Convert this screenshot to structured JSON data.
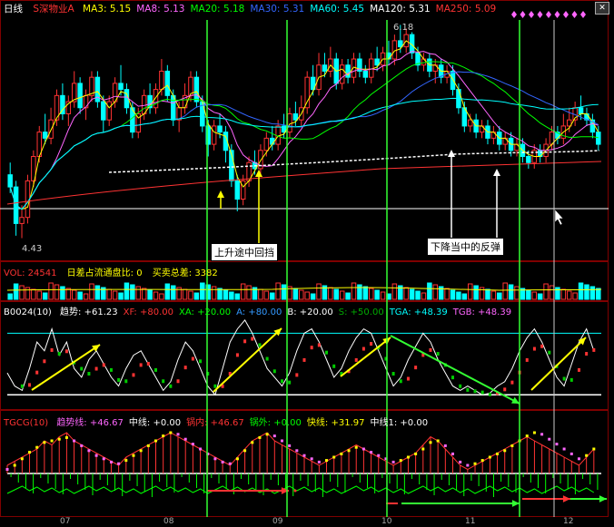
{
  "window": {
    "period_label": "日线",
    "close_glyph": "✕"
  },
  "price_panel": {
    "stock_name": "S深物业A",
    "ma": [
      {
        "label": "MA3:",
        "value": "5.15",
        "color": "#ffff00"
      },
      {
        "label": "MA8:",
        "value": "5.13",
        "color": "#ff66ff"
      },
      {
        "label": "MA20:",
        "value": "5.18",
        "color": "#00ff00"
      },
      {
        "label": "MA30:",
        "value": "5.31",
        "color": "#3366ff"
      },
      {
        "label": "MA60:",
        "value": "5.45",
        "color": "#00ffff"
      },
      {
        "label": "MA120:",
        "value": "5.31",
        "color": "#ffffff"
      },
      {
        "label": "MA250:",
        "value": "5.09",
        "color": "#ff3333"
      }
    ],
    "high_label": "6.18",
    "low_label": "4.43",
    "annotation_up": "上升途中回挡",
    "annotation_down": "下降当中的反弹"
  },
  "vol_panel": {
    "title": "VOL: 24541",
    "ratio": "日差占流通盘比: 0",
    "diff": "买卖总差: 3382"
  },
  "b0024_panel": {
    "name": "B0024(10)",
    "fields": [
      {
        "label": "趋势:",
        "value": "+61.23",
        "color": "#ffffff"
      },
      {
        "label": "XF:",
        "value": "+80.00",
        "color": "#ff3333"
      },
      {
        "label": "XA:",
        "value": "+20.00",
        "color": "#00ff00"
      },
      {
        "label": "A:",
        "value": "+80.00",
        "color": "#3399ff"
      },
      {
        "label": "B:",
        "value": "+20.00",
        "color": "#ffffff"
      },
      {
        "label": "S:",
        "value": "+50.00",
        "color": "#00aa00"
      },
      {
        "label": "TGA:",
        "value": "+48.39",
        "color": "#00ffff"
      },
      {
        "label": "TGB:",
        "value": "+48.39",
        "color": "#ff66ff"
      }
    ]
  },
  "tgcg_panel": {
    "name": "TGCG(10)",
    "fields": [
      {
        "label": "趋势线:",
        "value": "+46.67",
        "color": "#ff66ff"
      },
      {
        "label": "中线:",
        "value": "+0.00",
        "color": "#ffffff"
      },
      {
        "label": "锅内:",
        "value": "+46.67",
        "color": "#ff3333"
      },
      {
        "label": "锅外:",
        "value": "+0.00",
        "color": "#00ff00"
      },
      {
        "label": "快线:",
        "value": "+31.97",
        "color": "#ffff00"
      },
      {
        "label": "中线1:",
        "value": "+0.00",
        "color": "#ffffff"
      }
    ]
  },
  "date_axis": [
    "07",
    "08",
    "09",
    "10",
    "11",
    "12"
  ],
  "colors": {
    "up": "#ff3333",
    "down": "#00ffff",
    "vline": "#33ff33",
    "grid": "#800000",
    "arrow_yellow": "#ffff00",
    "arrow_green": "#33ff33"
  },
  "chart_data": {
    "type": "candlestick",
    "candles": [
      [
        4.95,
        4.85,
        5.05,
        4.8
      ],
      [
        4.85,
        4.55,
        4.9,
        4.45
      ],
      [
        4.55,
        4.6,
        4.7,
        4.43
      ],
      [
        4.6,
        4.9,
        4.95,
        4.55
      ],
      [
        4.9,
        5.1,
        5.15,
        4.85
      ],
      [
        5.1,
        5.3,
        5.35,
        5.05
      ],
      [
        5.3,
        5.25,
        5.45,
        5.2
      ],
      [
        5.25,
        5.4,
        5.5,
        5.2
      ],
      [
        5.4,
        5.6,
        5.65,
        5.35
      ],
      [
        5.6,
        5.45,
        5.7,
        5.4
      ],
      [
        5.45,
        5.55,
        5.6,
        5.35
      ],
      [
        5.55,
        5.7,
        5.8,
        5.5
      ],
      [
        5.7,
        5.5,
        5.75,
        5.45
      ],
      [
        5.5,
        5.6,
        5.65,
        5.4
      ],
      [
        5.6,
        5.75,
        5.8,
        5.55
      ],
      [
        5.75,
        5.55,
        5.8,
        5.5
      ],
      [
        5.55,
        5.4,
        5.6,
        5.3
      ],
      [
        5.4,
        5.55,
        5.6,
        5.35
      ],
      [
        5.55,
        5.7,
        5.75,
        5.5
      ],
      [
        5.7,
        5.65,
        5.85,
        5.6
      ],
      [
        5.65,
        5.5,
        5.7,
        5.45
      ],
      [
        5.5,
        5.3,
        5.55,
        5.25
      ],
      [
        5.3,
        5.45,
        5.5,
        5.25
      ],
      [
        5.45,
        5.6,
        5.65,
        5.4
      ],
      [
        5.6,
        5.5,
        5.7,
        5.45
      ],
      [
        5.5,
        5.65,
        5.7,
        5.45
      ],
      [
        5.65,
        5.8,
        5.9,
        5.6
      ],
      [
        5.8,
        5.6,
        5.85,
        5.55
      ],
      [
        5.6,
        5.4,
        5.65,
        5.35
      ],
      [
        5.4,
        5.5,
        5.55,
        5.3
      ],
      [
        5.5,
        5.6,
        5.7,
        5.45
      ],
      [
        5.6,
        5.75,
        5.8,
        5.55
      ],
      [
        5.75,
        5.55,
        5.8,
        5.5
      ],
      [
        5.55,
        5.35,
        5.6,
        5.3
      ],
      [
        5.35,
        5.2,
        5.4,
        5.1
      ],
      [
        5.2,
        5.35,
        5.4,
        5.15
      ],
      [
        5.35,
        5.3,
        5.45,
        5.25
      ],
      [
        5.3,
        5.15,
        5.35,
        5.05
      ],
      [
        5.15,
        4.9,
        5.2,
        4.85
      ],
      [
        4.9,
        4.75,
        4.95,
        4.65
      ],
      [
        4.75,
        4.9,
        4.95,
        4.7
      ],
      [
        4.9,
        5.05,
        5.1,
        4.85
      ],
      [
        5.05,
        5.0,
        5.15,
        4.95
      ],
      [
        5.0,
        5.15,
        5.2,
        4.95
      ],
      [
        5.15,
        5.25,
        5.3,
        5.1
      ],
      [
        5.25,
        5.2,
        5.35,
        5.15
      ],
      [
        5.2,
        5.35,
        5.4,
        5.15
      ],
      [
        5.35,
        5.3,
        5.45,
        5.25
      ],
      [
        5.3,
        5.45,
        5.5,
        5.25
      ],
      [
        5.45,
        5.4,
        5.55,
        5.35
      ],
      [
        5.4,
        5.5,
        5.6,
        5.35
      ],
      [
        5.5,
        5.75,
        5.8,
        5.45
      ],
      [
        5.75,
        5.65,
        5.85,
        5.6
      ],
      [
        5.65,
        5.85,
        5.95,
        5.6
      ],
      [
        5.85,
        5.8,
        5.95,
        5.75
      ],
      [
        5.8,
        5.9,
        6.0,
        5.75
      ],
      [
        5.9,
        5.7,
        5.95,
        5.65
      ],
      [
        5.7,
        5.85,
        5.9,
        5.65
      ],
      [
        5.85,
        5.75,
        5.9,
        5.7
      ],
      [
        5.75,
        5.9,
        5.95,
        5.7
      ],
      [
        5.9,
        5.8,
        5.95,
        5.75
      ],
      [
        5.8,
        5.75,
        5.85,
        5.7
      ],
      [
        5.75,
        5.9,
        5.95,
        5.7
      ],
      [
        5.9,
        5.85,
        6.0,
        5.8
      ],
      [
        5.85,
        5.95,
        6.0,
        5.8
      ],
      [
        5.95,
        5.9,
        6.05,
        5.85
      ],
      [
        5.9,
        6.05,
        6.1,
        5.85
      ],
      [
        6.05,
        6.0,
        6.18,
        5.95
      ],
      [
        6.0,
        6.1,
        6.15,
        5.95
      ],
      [
        6.1,
        5.95,
        6.12,
        5.9
      ],
      [
        5.95,
        5.85,
        6.0,
        5.8
      ],
      [
        5.85,
        5.9,
        5.95,
        5.8
      ],
      [
        5.9,
        5.8,
        5.95,
        5.75
      ],
      [
        5.8,
        5.85,
        5.9,
        5.7
      ],
      [
        5.85,
        5.75,
        5.9,
        5.7
      ],
      [
        5.75,
        5.8,
        5.85,
        5.7
      ],
      [
        5.8,
        5.65,
        5.85,
        5.6
      ],
      [
        5.65,
        5.5,
        5.7,
        5.45
      ],
      [
        5.5,
        5.35,
        5.55,
        5.3
      ],
      [
        5.35,
        5.4,
        5.45,
        5.3
      ],
      [
        5.4,
        5.3,
        5.45,
        5.25
      ],
      [
        5.3,
        5.35,
        5.4,
        5.25
      ],
      [
        5.35,
        5.25,
        5.4,
        5.2
      ],
      [
        5.25,
        5.3,
        5.35,
        5.2
      ],
      [
        5.3,
        5.2,
        5.35,
        5.15
      ],
      [
        5.2,
        5.25,
        5.3,
        5.15
      ],
      [
        5.25,
        5.15,
        5.3,
        5.1
      ],
      [
        5.15,
        5.2,
        5.25,
        5.1
      ],
      [
        5.2,
        5.1,
        5.25,
        5.05
      ],
      [
        5.1,
        5.05,
        5.15,
        5.0
      ],
      [
        5.05,
        5.15,
        5.2,
        5.0
      ],
      [
        5.15,
        5.1,
        5.2,
        5.05
      ],
      [
        5.1,
        5.2,
        5.25,
        5.05
      ],
      [
        5.2,
        5.3,
        5.35,
        5.15
      ],
      [
        5.3,
        5.25,
        5.35,
        5.2
      ],
      [
        5.25,
        5.35,
        5.45,
        5.2
      ],
      [
        5.35,
        5.4,
        5.5,
        5.3
      ],
      [
        5.4,
        5.5,
        5.55,
        5.35
      ],
      [
        5.5,
        5.45,
        5.6,
        5.4
      ],
      [
        5.45,
        5.4,
        5.5,
        5.35
      ],
      [
        5.4,
        5.3,
        5.45,
        5.25
      ],
      [
        5.3,
        5.2,
        5.35,
        5.15
      ]
    ],
    "ylim": [
      4.3,
      6.25
    ],
    "b0024_trend": [
      35,
      20,
      15,
      40,
      70,
      60,
      85,
      55,
      70,
      40,
      30,
      50,
      60,
      45,
      30,
      20,
      40,
      55,
      60,
      45,
      30,
      15,
      25,
      50,
      70,
      60,
      40,
      20,
      10,
      40,
      70,
      85,
      95,
      80,
      60,
      40,
      30,
      20,
      35,
      60,
      80,
      85,
      70,
      50,
      30,
      40,
      60,
      75,
      85,
      80,
      60,
      40,
      20,
      30,
      50,
      65,
      80,
      70,
      50,
      35,
      20,
      15,
      20,
      15,
      10,
      12,
      20,
      25,
      40,
      60,
      75,
      85,
      70,
      50,
      30,
      20,
      45,
      70,
      85,
      60
    ],
    "tgcg_red": [
      10,
      15,
      20,
      25,
      30,
      40,
      35,
      45,
      50,
      40,
      35,
      30,
      25,
      20,
      15,
      10,
      20,
      25,
      30,
      35,
      40,
      45,
      50,
      45,
      40,
      35,
      30,
      25,
      20,
      15,
      10,
      20,
      30,
      40,
      45,
      50,
      40,
      35,
      30,
      25,
      20,
      15,
      10,
      15,
      20,
      25,
      30,
      35,
      30,
      25,
      20,
      15,
      10,
      15,
      20,
      25,
      35,
      45,
      40,
      30,
      20,
      10,
      5,
      10,
      15,
      20,
      25,
      30,
      35,
      40,
      45,
      40,
      35,
      30,
      25,
      20,
      15,
      10,
      20,
      30
    ],
    "tgcg_yellow": [
      5,
      10,
      18,
      26,
      32,
      38,
      40,
      42,
      44,
      40,
      34,
      28,
      22,
      18,
      14,
      12,
      16,
      22,
      28,
      34,
      40,
      46,
      50,
      48,
      42,
      36,
      30,
      24,
      18,
      14,
      12,
      18,
      28,
      38,
      44,
      48,
      46,
      40,
      34,
      28,
      22,
      18,
      14,
      16,
      20,
      24,
      28,
      32,
      30,
      26,
      22,
      18,
      14,
      16,
      20,
      24,
      30,
      38,
      40,
      34,
      24,
      14,
      10,
      12,
      16,
      20,
      24,
      28,
      34,
      40,
      46,
      50,
      48,
      42,
      36,
      30,
      24,
      18,
      22,
      30
    ]
  }
}
